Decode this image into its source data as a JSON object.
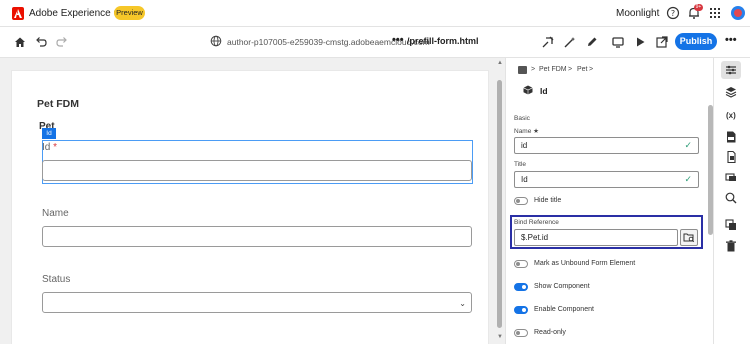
{
  "header": {
    "app_title": "Adobe Experience Cloud",
    "badge": "Preview",
    "user_name": "Moonlight",
    "notification_count": "9+"
  },
  "toolbar": {
    "url": "author-p107005-e259039-cmstg.adobeaemcloud.com",
    "more": "•••",
    "path": "/prefill-form.html",
    "publish_label": "Publish",
    "more_menu": "•••"
  },
  "canvas": {
    "form_title": "Pet FDM",
    "panel_title": "Pet",
    "selected_tag": "Id",
    "fields": [
      {
        "label": "Id",
        "required": "*"
      },
      {
        "label": "Name"
      },
      {
        "label": "Status",
        "chevron": "⌄"
      }
    ]
  },
  "properties": {
    "breadcrumb": [
      ">",
      "Pet FDM",
      ">",
      "Pet",
      ">"
    ],
    "selected_name": "Id",
    "section": "Basic",
    "name_label": "Name ★",
    "name_value": "id",
    "title_label": "Title",
    "title_value": "Id",
    "hide_title": "Hide title",
    "bind_label": "Bind Reference",
    "bind_value": "$.Pet.id",
    "toggles": [
      {
        "label": "Mark as Unbound Form Element",
        "on": false
      },
      {
        "label": "Show Component",
        "on": true
      },
      {
        "label": "Enable Component",
        "on": true
      },
      {
        "label": "Read-only",
        "on": false
      }
    ],
    "check": "✓"
  },
  "rail": {
    "variables": "(x)"
  },
  "colors": {
    "accent": "#1473e6",
    "brand_red": "#eb1000",
    "badge_yellow": "#f6c729",
    "highlight_border": "#2a2fa5"
  }
}
